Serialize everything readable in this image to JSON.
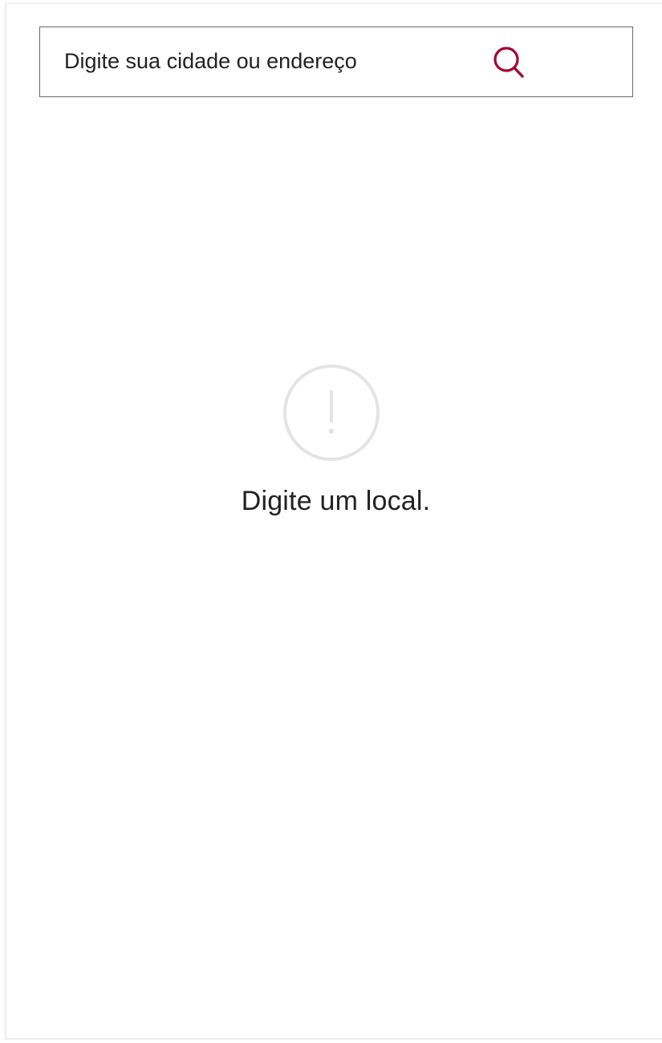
{
  "search": {
    "placeholder": "Digite sua cidade ou endereço",
    "value": "",
    "button_icon": "search-icon"
  },
  "empty_state": {
    "icon": "exclamation-circle-icon",
    "message": "Digite um local."
  },
  "colors": {
    "accent": "#a50034",
    "text": "#222222",
    "border": "#6b6b6b",
    "icon_muted": "#e4e4e4"
  }
}
